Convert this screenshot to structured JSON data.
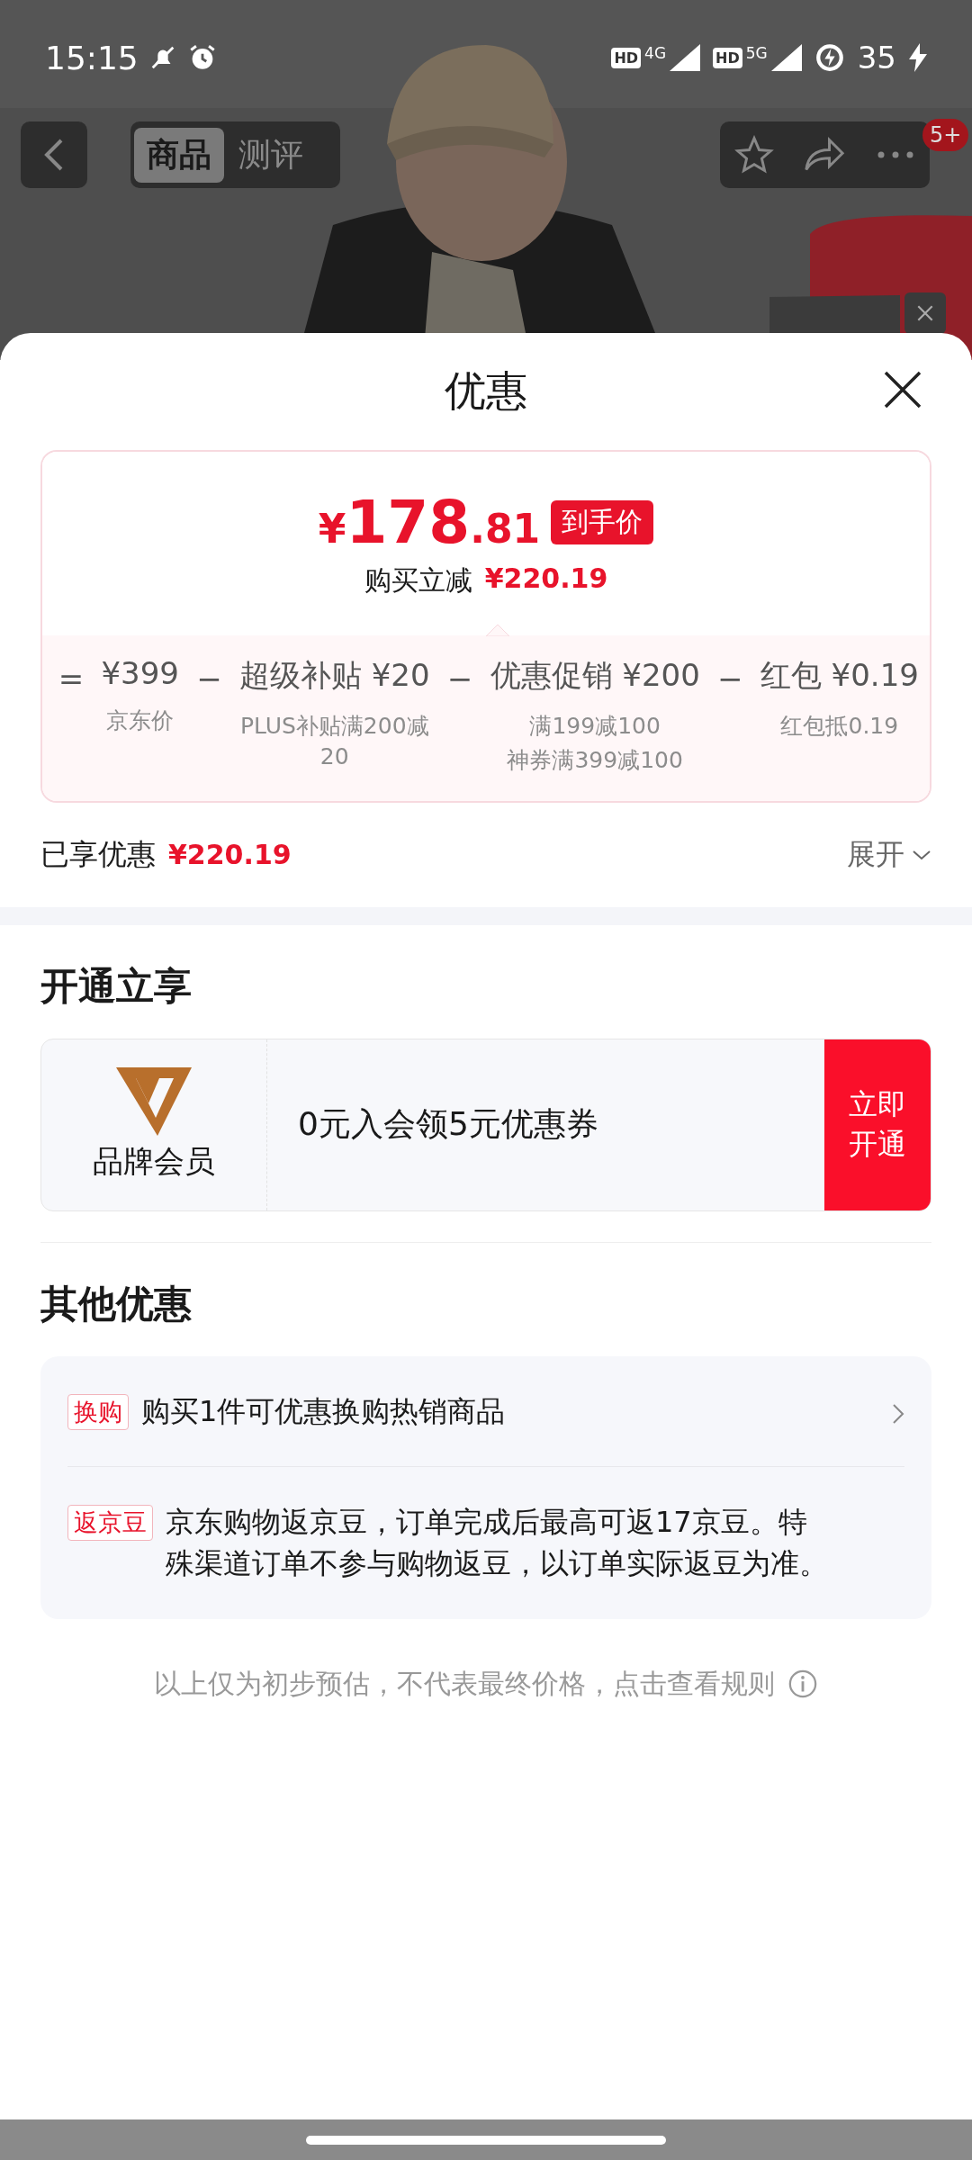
{
  "status_bar": {
    "time": "15:15",
    "networks": [
      {
        "hd": "HD",
        "type": "4G"
      },
      {
        "hd": "HD",
        "type": "5G"
      }
    ],
    "battery": "35"
  },
  "product_nav": {
    "tabs": [
      {
        "label": "商品",
        "selected": true
      },
      {
        "label": "测评",
        "selected": false
      }
    ],
    "badge": "5+"
  },
  "sheet": {
    "title": "优惠",
    "price": {
      "currency": "¥",
      "integer": "178",
      "decimal": ".81",
      "tag": "到手价",
      "saving_label": "购买立减",
      "saving": "¥220.19"
    },
    "breakdown": [
      {
        "operator": "=",
        "title": "¥399",
        "notes": [
          "京东价"
        ]
      },
      {
        "operator": "−",
        "title": "超级补贴 ¥20",
        "notes": [
          "PLUS补贴满200减20"
        ]
      },
      {
        "operator": "−",
        "title": "优惠促销 ¥200",
        "notes": [
          "满199减100",
          "神券满399减100"
        ]
      },
      {
        "operator": "−",
        "title": "红包 ¥0.19",
        "notes": [
          "红包抵0.19"
        ]
      }
    ],
    "enjoyed": {
      "label": "已享优惠",
      "amount": "¥220.19",
      "expand": "展开"
    },
    "membership": {
      "heading": "开通立享",
      "brand_label": "品牌会员",
      "offer": "0元入会领5元优惠券",
      "button": "立即开通"
    },
    "others": {
      "heading": "其他优惠",
      "items": [
        {
          "kind": "link",
          "tag": "换购",
          "text": "购买1件可优惠换购热销商品"
        },
        {
          "kind": "info",
          "tag": "返京豆",
          "text": "京东购物返京豆，订单完成后最高可返17京豆。特殊渠道订单不参与购物返豆，以订单实际返豆为准。"
        }
      ]
    },
    "footer": "以上仅为初步预估，不代表最终价格，点击查看规则"
  }
}
